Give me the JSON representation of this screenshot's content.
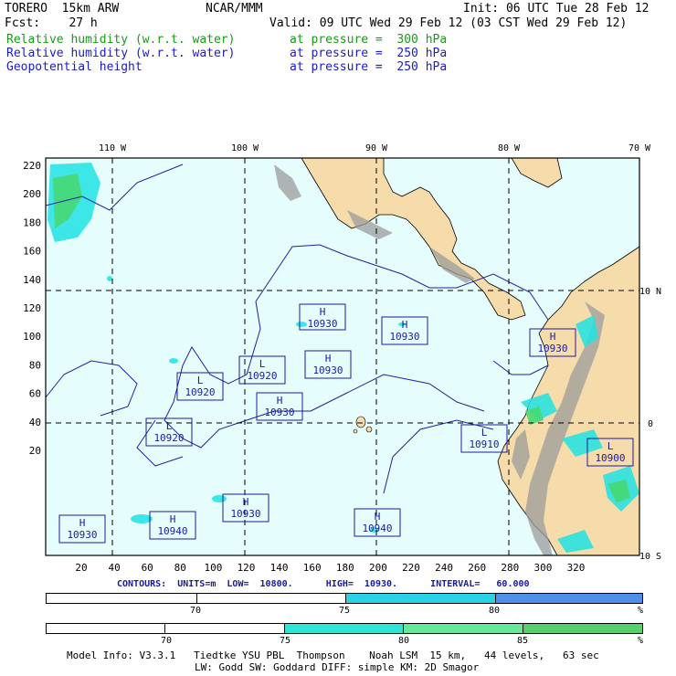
{
  "header": {
    "model": "TORERO  15km ARW",
    "center": "NCAR/MMM",
    "init": "Init: 06 UTC Tue 28 Feb 12",
    "fcst": "Fcst:    27 h",
    "valid": "Valid: 09 UTC Wed 29 Feb 12 (03 CST Wed 29 Feb 12)",
    "fields": [
      {
        "name": "Relative humidity (w.r.t. water)",
        "level": "at pressure =  300 hPa",
        "color": "#1a9a1a"
      },
      {
        "name": "Relative humidity (w.r.t. water)",
        "level": "at pressure =  250 hPa",
        "color": "#1a1ad0"
      },
      {
        "name": "Geopotential height",
        "level": "at pressure =  250 hPa",
        "color": "#1a1ad0"
      }
    ]
  },
  "map": {
    "top_lon_labels": [
      "110 W",
      "100 W",
      "90 W",
      "80 W",
      "70 W"
    ],
    "right_lat_labels": [
      "10 N",
      "0",
      "10 S"
    ],
    "left_y_ticks": [
      "220",
      "200",
      "180",
      "160",
      "140",
      "120",
      "100",
      "80",
      "60",
      "40",
      "20"
    ],
    "bottom_x_ticks": [
      "20",
      "40",
      "60",
      "80",
      "100",
      "120",
      "140",
      "160",
      "180",
      "200",
      "220",
      "240",
      "260",
      "280",
      "300",
      "320"
    ],
    "pressure_centers": [
      {
        "type": "H",
        "value": "10930"
      },
      {
        "type": "H",
        "value": "10930"
      },
      {
        "type": "H",
        "value": "10930"
      },
      {
        "type": "L",
        "value": "10920"
      },
      {
        "type": "H",
        "value": "10930"
      },
      {
        "type": "L",
        "value": "10920"
      },
      {
        "type": "H",
        "value": "10930"
      },
      {
        "type": "L",
        "value": "10920"
      },
      {
        "type": "L",
        "value": "10910"
      },
      {
        "type": "L",
        "value": "10900"
      },
      {
        "type": "H",
        "value": "10930"
      },
      {
        "type": "H",
        "value": "10940"
      },
      {
        "type": "H",
        "value": "10930"
      },
      {
        "type": "H",
        "value": "10940"
      }
    ],
    "colors": {
      "ocean": "#e6fdfd",
      "land": "#f7dcab",
      "terrain": "#9a9a9a",
      "rh70": "#1fe3e3",
      "rh80": "#46d873"
    }
  },
  "contours_info": "CONTOURS:  UNITS=m  LOW=  10800.      HIGH=  10930.      INTERVAL=   60.000",
  "bars": [
    {
      "labels": [
        "70",
        "75",
        "80",
        "%"
      ],
      "colors": [
        "#ffffff",
        "#ffffff",
        "#29d2e6",
        "#4e8fe8"
      ]
    },
    {
      "labels": [
        "70",
        "75",
        "80",
        "85",
        "%"
      ],
      "colors": [
        "#ffffff",
        "#ffffff",
        "#2ee6d6",
        "#66e89a",
        "#55d06a"
      ]
    }
  ],
  "footer": {
    "line1": "Model Info: V3.3.1   Tiedtke YSU PBL  Thompson    Noah LSM  15 km,   44 levels,   63 sec",
    "line2": "LW: Godd SW: Goddard DIFF: simple KM: 2D Smagor"
  }
}
